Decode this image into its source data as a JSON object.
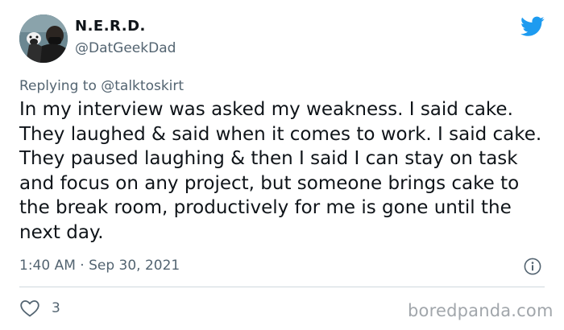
{
  "author": {
    "display_name": "N.E.R.D.",
    "handle": "@DatGeekDad",
    "avatar_icon": "profile-photo"
  },
  "brand": {
    "icon": "twitter-bird-icon",
    "color": "#1d9bf0"
  },
  "reply": {
    "prefix": "Replying to",
    "to_handle": "@talktoskirt"
  },
  "tweet": {
    "text": "In my interview was asked my weakness. I said cake. They laughed & said when it comes to work. I said cake. They paused laughing & then I said I can stay on task and focus on any project, but someone brings cake to the break room, productively for me is gone until the next day.",
    "timestamp": "1:40 AM · Sep 30, 2021"
  },
  "actions": {
    "like_icon": "heart-icon",
    "like_count": "3",
    "info_icon": "info-icon"
  },
  "watermark": {
    "text": "boredpanda.com"
  },
  "colors": {
    "text_primary": "#0f1419",
    "text_secondary": "#536471",
    "divider": "#cfd9de",
    "watermark": "#a1a6ab"
  }
}
